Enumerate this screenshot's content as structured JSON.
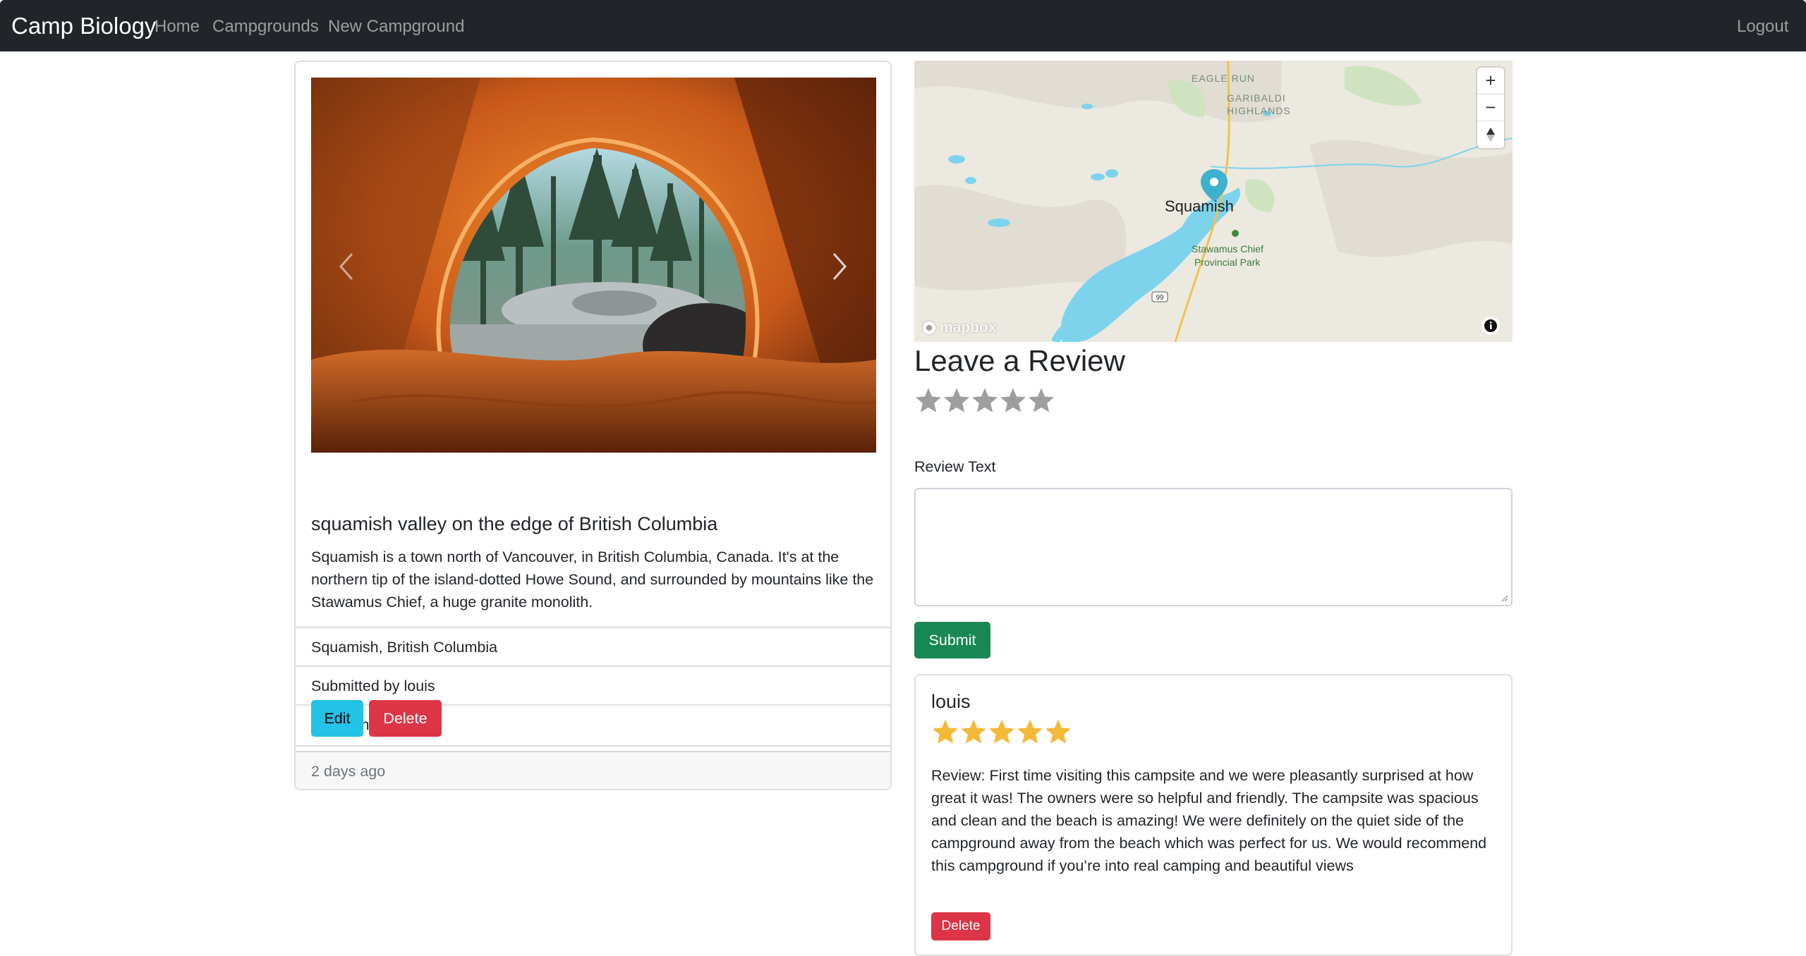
{
  "navbar": {
    "brand": "Camp Biology",
    "links": [
      "Home",
      "Campgrounds",
      "New Campground"
    ],
    "logout": "Logout",
    "background": "#212529"
  },
  "campground": {
    "title": "squamish valley on the edge of British Columbia",
    "description": "Squamish is a town north of Vancouver, in British Columbia, Canada. It's at the northern tip of the island-dotted Howe Sound, and surrounded by mountains like the Stawamus Chief, a huge granite monolith.",
    "location": "Squamish, British Columbia",
    "submitted_by": "Submitted by louis",
    "price": "$10/night",
    "edit_label": "Edit",
    "delete_label": "Delete",
    "posted": "2 days ago",
    "image_icon": "tent-view-photo",
    "carousel_prev_icon": "chevron-left-icon",
    "carousel_next_icon": "chevron-right-icon"
  },
  "map": {
    "labels": {
      "eagle_run": "EAGLE RUN",
      "garibaldi": "GARIBALDI",
      "highlands": "HIGHLANDS",
      "town": "Squamish",
      "park_line1": "Stawamus Chief",
      "park_line2": "Provincial Park",
      "highway": "99"
    },
    "logo": "mapbox",
    "zoom_in": "+",
    "zoom_out": "−",
    "water_color": "#7dd3ec",
    "land_color": "#ece9e1"
  },
  "review_form": {
    "heading": "Leave a Review",
    "rating_value": 0,
    "rating_max": 5,
    "text_label": "Review Text",
    "textarea_value": "",
    "submit_label": "Submit"
  },
  "reviews": [
    {
      "author": "louis",
      "rating": 5,
      "text": "Review: First time visiting this campsite and we were pleasantly surprised at how great it was! The owners were so helpful and friendly. The campsite was spacious and clean and the beach is amazing! We were definitely on the quiet side of the campground away from the beach which was perfect for us. We would recommend this campground if you’re into real camping and beautiful views",
      "delete_label": "Delete"
    }
  ],
  "colors": {
    "edit": "#22c3e6",
    "delete": "#dc3545",
    "submit": "#198754",
    "star_filled": "#f5b93a",
    "star_empty": "#9e9e9e"
  }
}
